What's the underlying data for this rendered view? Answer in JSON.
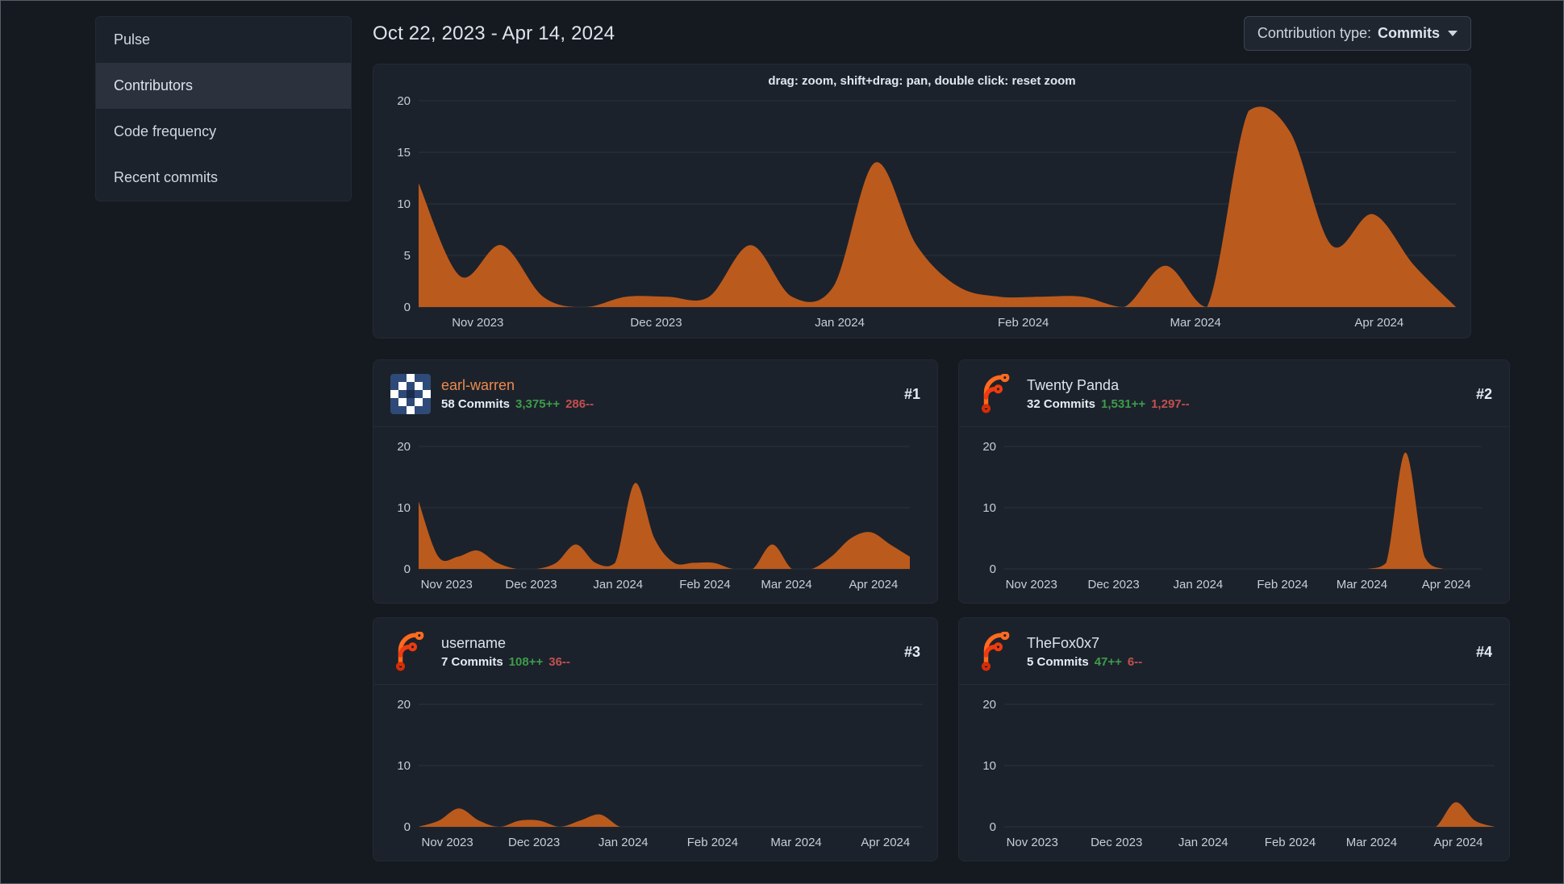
{
  "colors": {
    "chart_fill": "#bb5a1d",
    "gridline": "#2b323d",
    "link_orange": "#ec8a4c",
    "additions_green": "#3d9c4b",
    "deletions_red": "#c25050"
  },
  "sidebar": {
    "active_index": 1,
    "items": [
      {
        "label": "Pulse"
      },
      {
        "label": "Contributors"
      },
      {
        "label": "Code frequency"
      },
      {
        "label": "Recent commits"
      }
    ]
  },
  "header": {
    "date_range": "Oct 22, 2023 - Apr 14, 2024",
    "contribution_type_label": "Contribution type:",
    "contribution_type_value": "Commits"
  },
  "icons": {
    "contribution_type_caret": "chevron-down",
    "avatars": [
      "identicon",
      "forgejo-logo",
      "forgejo-logo",
      "forgejo-logo"
    ]
  },
  "contributors": [
    {
      "rank": "#1",
      "name": "earl-warren",
      "commits": "58 Commits",
      "additions": "3,375++",
      "deletions": "286--",
      "avatar_icon": "identicon"
    },
    {
      "rank": "#2",
      "name": "Twenty Panda",
      "commits": "32 Commits",
      "additions": "1,531++",
      "deletions": "1,297--",
      "avatar_icon": "forgejo-logo"
    },
    {
      "rank": "#3",
      "name": "username",
      "commits": "7 Commits",
      "additions": "108++",
      "deletions": "36--",
      "avatar_icon": "forgejo-logo"
    },
    {
      "rank": "#4",
      "name": "TheFox0x7",
      "commits": "5 Commits",
      "additions": "47++",
      "deletions": "6--",
      "avatar_icon": "forgejo-logo"
    }
  ],
  "chart_data": [
    {
      "type": "area",
      "name": "all-contributions-commits-per-week",
      "hint": "drag: zoom, shift+drag: pan, double click: reset zoom",
      "x_start": "Oct 22, 2023",
      "x_end": "Apr 14, 2024",
      "values": [
        12,
        3,
        6,
        1,
        0,
        1,
        1,
        1,
        6,
        1,
        2,
        14,
        6,
        2,
        1,
        1,
        1,
        0,
        4,
        0,
        19,
        17,
        6,
        9,
        4,
        0
      ],
      "ylim": [
        0,
        20
      ],
      "y_ticks": [
        0,
        5,
        10,
        15,
        20
      ],
      "x_ticks": [
        {
          "label": "Nov 2023",
          "pos": 0.057
        },
        {
          "label": "Dec 2023",
          "pos": 0.229
        },
        {
          "label": "Jan 2024",
          "pos": 0.406
        },
        {
          "label": "Feb 2024",
          "pos": 0.583
        },
        {
          "label": "Mar 2024",
          "pos": 0.749
        },
        {
          "label": "Apr 2024",
          "pos": 0.926
        }
      ]
    },
    {
      "type": "area",
      "name": "earl-warren-commits-per-week",
      "values": [
        11,
        2,
        2,
        3,
        1,
        0,
        0,
        1,
        4,
        1,
        1,
        14,
        5,
        1,
        1,
        1,
        0,
        0,
        4,
        0,
        0,
        2,
        5,
        6,
        4,
        2
      ],
      "ylim": [
        0,
        20
      ],
      "y_ticks": [
        0,
        10,
        20
      ],
      "x_ticks": [
        {
          "label": "Nov 2023",
          "pos": 0.057
        },
        {
          "label": "Dec 2023",
          "pos": 0.229
        },
        {
          "label": "Jan 2024",
          "pos": 0.406
        },
        {
          "label": "Feb 2024",
          "pos": 0.583
        },
        {
          "label": "Mar 2024",
          "pos": 0.749
        },
        {
          "label": "Apr 2024",
          "pos": 0.926
        }
      ]
    },
    {
      "type": "area",
      "name": "twenty-panda-commits-per-week",
      "values": [
        0,
        0,
        0,
        0,
        0,
        0,
        0,
        0,
        0,
        0,
        0,
        0,
        0,
        0,
        0,
        0,
        0,
        0,
        0,
        0,
        1,
        19,
        2,
        0,
        0,
        0
      ],
      "ylim": [
        0,
        20
      ],
      "y_ticks": [
        0,
        10,
        20
      ],
      "x_ticks": [
        {
          "label": "Nov 2023",
          "pos": 0.057
        },
        {
          "label": "Dec 2023",
          "pos": 0.229
        },
        {
          "label": "Jan 2024",
          "pos": 0.406
        },
        {
          "label": "Feb 2024",
          "pos": 0.583
        },
        {
          "label": "Mar 2024",
          "pos": 0.749
        },
        {
          "label": "Apr 2024",
          "pos": 0.926
        }
      ]
    },
    {
      "type": "area",
      "name": "username-commits-per-week",
      "values": [
        0,
        1,
        3,
        1,
        0,
        1,
        1,
        0,
        1,
        2,
        0,
        0,
        0,
        0,
        0,
        0,
        0,
        0,
        0,
        0,
        0,
        0,
        0,
        0,
        0,
        0
      ],
      "ylim": [
        0,
        20
      ],
      "y_ticks": [
        0,
        10,
        20
      ],
      "x_ticks": [
        {
          "label": "Nov 2023",
          "pos": 0.057
        },
        {
          "label": "Dec 2023",
          "pos": 0.229
        },
        {
          "label": "Jan 2024",
          "pos": 0.406
        },
        {
          "label": "Feb 2024",
          "pos": 0.583
        },
        {
          "label": "Mar 2024",
          "pos": 0.749
        },
        {
          "label": "Apr 2024",
          "pos": 0.926
        }
      ]
    },
    {
      "type": "area",
      "name": "thefox0x7-commits-per-week",
      "values": [
        0,
        0,
        0,
        0,
        0,
        0,
        0,
        0,
        0,
        0,
        0,
        0,
        0,
        0,
        0,
        0,
        0,
        0,
        0,
        0,
        0,
        0,
        0,
        4,
        1,
        0
      ],
      "ylim": [
        0,
        20
      ],
      "y_ticks": [
        0,
        10,
        20
      ],
      "x_ticks": [
        {
          "label": "Nov 2023",
          "pos": 0.057
        },
        {
          "label": "Dec 2023",
          "pos": 0.229
        },
        {
          "label": "Jan 2024",
          "pos": 0.406
        },
        {
          "label": "Feb 2024",
          "pos": 0.583
        },
        {
          "label": "Mar 2024",
          "pos": 0.749
        },
        {
          "label": "Apr 2024",
          "pos": 0.926
        }
      ]
    }
  ]
}
